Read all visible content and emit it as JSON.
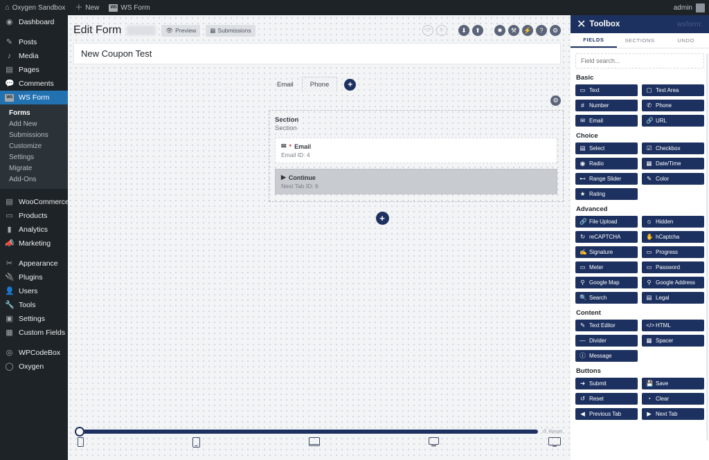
{
  "adminbar": {
    "site": "Oxygen Sandbox",
    "new": "New",
    "plugin": "WS Form",
    "plugin_badge": "WS",
    "user": "admin"
  },
  "sidebar": {
    "items": [
      {
        "label": "Dashboard",
        "icon": "dashboard-icon",
        "glyph": "◉"
      },
      {
        "label": "Posts",
        "icon": "pin-icon",
        "glyph": "✎"
      },
      {
        "label": "Media",
        "icon": "media-icon",
        "glyph": "♪"
      },
      {
        "label": "Pages",
        "icon": "pages-icon",
        "glyph": "▤"
      },
      {
        "label": "Comments",
        "icon": "comments-icon",
        "glyph": "💬"
      },
      {
        "label": "WS Form",
        "icon": "wsform-icon",
        "glyph": "WS",
        "current": true
      }
    ],
    "submenu": [
      {
        "label": "Forms",
        "active": true
      },
      {
        "label": "Add New"
      },
      {
        "label": "Submissions"
      },
      {
        "label": "Customize"
      },
      {
        "label": "Settings"
      },
      {
        "label": "Migrate"
      },
      {
        "label": "Add-Ons"
      }
    ],
    "items2": [
      {
        "label": "WooCommerce",
        "icon": "woocommerce-icon",
        "glyph": "▤"
      },
      {
        "label": "Products",
        "icon": "products-icon",
        "glyph": "▭"
      },
      {
        "label": "Analytics",
        "icon": "analytics-icon",
        "glyph": "▮"
      },
      {
        "label": "Marketing",
        "icon": "marketing-icon",
        "glyph": "📣"
      }
    ],
    "items3": [
      {
        "label": "Appearance",
        "icon": "appearance-icon",
        "glyph": "✂"
      },
      {
        "label": "Plugins",
        "icon": "plugins-icon",
        "glyph": "🔌"
      },
      {
        "label": "Users",
        "icon": "users-icon",
        "glyph": "👤"
      },
      {
        "label": "Tools",
        "icon": "tools-icon",
        "glyph": "🔧"
      },
      {
        "label": "Settings",
        "icon": "settings-icon",
        "glyph": "▣"
      },
      {
        "label": "Custom Fields",
        "icon": "custom-fields-icon",
        "glyph": "▦"
      }
    ],
    "items4": [
      {
        "label": "WPCodeBox",
        "icon": "wpcodebox-icon",
        "glyph": "◎"
      },
      {
        "label": "Oxygen",
        "icon": "oxygen-icon",
        "glyph": "◯"
      }
    ]
  },
  "editor": {
    "heading": "Edit Form",
    "preview_label": "Preview",
    "submissions_label": "Submissions",
    "form_title": "New Coupon Test",
    "tools": [
      {
        "name": "undo-icon",
        "glyph": "↺",
        "style": "ghost"
      },
      {
        "name": "redo-icon",
        "glyph": "↻",
        "style": "ghost"
      },
      {
        "name": "import-icon",
        "glyph": "⬇"
      },
      {
        "name": "export-icon",
        "glyph": "⬆"
      },
      {
        "name": "actions-icon",
        "glyph": "✹"
      },
      {
        "name": "repair-icon",
        "glyph": "⚒"
      },
      {
        "name": "conditional-logic-icon",
        "glyph": "⚡"
      },
      {
        "name": "help-icon",
        "glyph": "?"
      },
      {
        "name": "form-settings-icon",
        "glyph": "⚙"
      }
    ],
    "tabs": [
      {
        "label": "Email",
        "active": false
      },
      {
        "label": "Phone",
        "active": true
      }
    ],
    "add_tab_glyph": "+",
    "section_gear_glyph": "⚙",
    "section": {
      "title": "Section",
      "subtitle": "Section"
    },
    "fields": [
      {
        "icon": "email-icon",
        "glyph": "✉",
        "required": "*",
        "label": "Email",
        "meta": "Email ID: 4",
        "kind": "field"
      },
      {
        "icon": "next-tab-icon",
        "glyph": "▶",
        "required": "",
        "label": "Continue",
        "meta": "Next Tab ID: 6",
        "kind": "action"
      }
    ],
    "add_field_glyph": "+",
    "responsive": {
      "reset_label": "Reset",
      "reset_glyph": "↺",
      "devices": [
        {
          "name": "device-mobile",
          "w": 7,
          "h": 12
        },
        {
          "name": "device-mobile-large",
          "w": 10,
          "h": 14
        },
        {
          "name": "device-tablet",
          "w": 14,
          "h": 11
        },
        {
          "name": "device-laptop",
          "w": 15,
          "h": 11
        },
        {
          "name": "device-desktop",
          "w": 16,
          "h": 12
        }
      ],
      "slider_value": 0
    }
  },
  "toolbox": {
    "title": "Toolbox",
    "logo_glyph": "✕",
    "brand": "wsform:",
    "tabs": [
      {
        "label": "FIELDS",
        "active": true
      },
      {
        "label": "SECTIONS",
        "active": false
      },
      {
        "label": "UNDO",
        "active": false
      }
    ],
    "search_placeholder": "Field search...",
    "groups": [
      {
        "name": "Basic",
        "items": [
          {
            "label": "Text",
            "icon": "text-icon",
            "glyph": "▭"
          },
          {
            "label": "Text Area",
            "icon": "textarea-icon",
            "glyph": "▢"
          },
          {
            "label": "Number",
            "icon": "number-icon",
            "glyph": "#"
          },
          {
            "label": "Phone",
            "icon": "phone-icon",
            "glyph": "✆"
          },
          {
            "label": "Email",
            "icon": "email-icon",
            "glyph": "✉"
          },
          {
            "label": "URL",
            "icon": "url-icon",
            "glyph": "🔗"
          }
        ]
      },
      {
        "name": "Choice",
        "items": [
          {
            "label": "Select",
            "icon": "select-icon",
            "glyph": "▤"
          },
          {
            "label": "Checkbox",
            "icon": "checkbox-icon",
            "glyph": "☑"
          },
          {
            "label": "Radio",
            "icon": "radio-icon",
            "glyph": "◉"
          },
          {
            "label": "Date/Time",
            "icon": "datetime-icon",
            "glyph": "▦"
          },
          {
            "label": "Range Slider",
            "icon": "range-slider-icon",
            "glyph": "⊷"
          },
          {
            "label": "Color",
            "icon": "color-icon",
            "glyph": "✎"
          },
          {
            "label": "Rating",
            "icon": "rating-icon",
            "glyph": "★"
          }
        ]
      },
      {
        "name": "Advanced",
        "items": [
          {
            "label": "File Upload",
            "icon": "file-upload-icon",
            "glyph": "🔗"
          },
          {
            "label": "Hidden",
            "icon": "hidden-icon",
            "glyph": "⦸"
          },
          {
            "label": "reCAPTCHA",
            "icon": "recaptcha-icon",
            "glyph": "↻"
          },
          {
            "label": "hCaptcha",
            "icon": "hcaptcha-icon",
            "glyph": "✋"
          },
          {
            "label": "Signature",
            "icon": "signature-icon",
            "glyph": "✍"
          },
          {
            "label": "Progress",
            "icon": "progress-icon",
            "glyph": "▭"
          },
          {
            "label": "Meter",
            "icon": "meter-icon",
            "glyph": "▭"
          },
          {
            "label": "Password",
            "icon": "password-icon",
            "glyph": "▭"
          },
          {
            "label": "Google Map",
            "icon": "google-map-icon",
            "glyph": "⚲"
          },
          {
            "label": "Google Address",
            "icon": "google-address-icon",
            "glyph": "⚲"
          },
          {
            "label": "Search",
            "icon": "search-icon",
            "glyph": "🔍"
          },
          {
            "label": "Legal",
            "icon": "legal-icon",
            "glyph": "▤"
          }
        ]
      },
      {
        "name": "Content",
        "items": [
          {
            "label": "Text Editor",
            "icon": "text-editor-icon",
            "glyph": "✎"
          },
          {
            "label": "HTML",
            "icon": "html-icon",
            "glyph": "</>"
          },
          {
            "label": "Divider",
            "icon": "divider-icon",
            "glyph": "—"
          },
          {
            "label": "Spacer",
            "icon": "spacer-icon",
            "glyph": "▦"
          },
          {
            "label": "Message",
            "icon": "message-icon",
            "glyph": "ⓘ"
          }
        ]
      },
      {
        "name": "Buttons",
        "items": [
          {
            "label": "Submit",
            "icon": "submit-icon",
            "glyph": "➜"
          },
          {
            "label": "Save",
            "icon": "save-icon",
            "glyph": "💾"
          },
          {
            "label": "Reset",
            "icon": "reset-icon",
            "glyph": "↺"
          },
          {
            "label": "Clear",
            "icon": "clear-icon",
            "glyph": "◔"
          },
          {
            "label": "Previous Tab",
            "icon": "previous-tab-icon",
            "glyph": "◀"
          },
          {
            "label": "Next Tab",
            "icon": "next-tab-icon",
            "glyph": "▶"
          }
        ]
      }
    ]
  },
  "colors": {
    "navy": "#1d3160",
    "admin_dark": "#1d2327",
    "admin_submenu": "#2c3338",
    "current_blue": "#2271b1",
    "required_red": "#d63638"
  }
}
